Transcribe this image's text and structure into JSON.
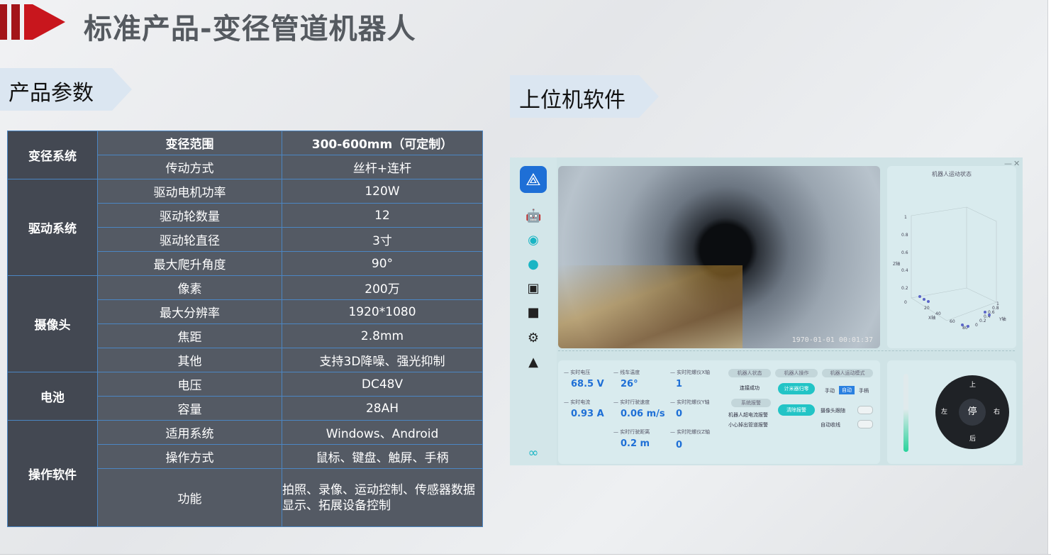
{
  "title": "标准产品-变径管道机器人",
  "sections": {
    "params_label": "产品参数",
    "software_label": "上位机软件"
  },
  "spec_table": {
    "groups": [
      {
        "name": "变径系统",
        "rows": [
          [
            "变径范围",
            "300-600mm（可定制）"
          ],
          [
            "传动方式",
            "丝杆+连杆"
          ]
        ]
      },
      {
        "name": "驱动系统",
        "rows": [
          [
            "驱动电机功率",
            "120W"
          ],
          [
            "驱动轮数量",
            "12"
          ],
          [
            "驱动轮直径",
            "3寸"
          ],
          [
            "最大爬升角度",
            "90°"
          ]
        ]
      },
      {
        "name": "摄像头",
        "rows": [
          [
            "像素",
            "200万"
          ],
          [
            "最大分辨率",
            "1920*1080"
          ],
          [
            "焦距",
            "2.8mm"
          ],
          [
            "其他",
            "支持3D降噪、强光抑制"
          ]
        ]
      },
      {
        "name": "电池",
        "rows": [
          [
            "电压",
            "DC48V"
          ],
          [
            "容量",
            "28AH"
          ]
        ]
      },
      {
        "name": "操作软件",
        "rows": [
          [
            "适用系统",
            "Windows、Android"
          ],
          [
            "操作方式",
            "鼠标、键盘、触屏、手柄"
          ],
          [
            "功能",
            "拍照、录像、运动控制、传感器数据显示、拓展设备控制"
          ]
        ]
      }
    ]
  },
  "software": {
    "window_controls": [
      "—",
      "✕"
    ],
    "camera_timestamp": "1970-01-01 00:01:37",
    "chart_title": "机器人运动状态",
    "chart_axes": {
      "z": "Z轴",
      "x": "X轴",
      "y": "Y轴"
    },
    "chart_ticks_z": [
      "1",
      "0.8",
      "0.6",
      "0.4",
      "0.2",
      "0"
    ],
    "chart_ticks_x": [
      "20",
      "40",
      "60",
      "80"
    ],
    "chart_ticks_y": [
      "0",
      "0.2",
      "0.4",
      "0.6",
      "0.8",
      "1"
    ],
    "metrics": {
      "voltage_label": "— 实时电压",
      "voltage_value": "68.5 V",
      "temp_label": "— 线车温度",
      "temp_value": "26°",
      "gyro_x_label": "— 实时陀螺仪X轴",
      "gyro_x_value": "1",
      "current_label": "— 实时电流",
      "current_value": "0.93 A",
      "speed_label": "— 实时行驶速度",
      "speed_value": "0.06 m/s",
      "gyro_y_label": "— 实时陀螺仪Y轴",
      "gyro_y_value": "0",
      "distance_label": "— 实时行驶距离",
      "distance_value": "0.2 m",
      "gyro_z_label": "— 实时陀螺仪Z轴",
      "gyro_z_value": "0"
    },
    "status": {
      "robot_state_hdr": "机器人状态",
      "robot_op_hdr": "机器人操作",
      "robot_mode_hdr": "机器人运动模式",
      "connected": "连接成功",
      "system_alarm_hdr": "系统报警",
      "alarm1": "机器人超电流报警",
      "alarm2": "小心掉出管道报警",
      "btn_counter_reset": "计米器归零",
      "btn_clear_alarm": "清除报警",
      "mode_manual": "手动",
      "mode_auto": "自动",
      "mode_handle": "手柄",
      "camera_follow": "摄像头跟随",
      "auto_cable": "自动收线"
    },
    "joystick": {
      "center": "停",
      "left": "左",
      "right": "右",
      "up": "上",
      "down": "后"
    }
  }
}
